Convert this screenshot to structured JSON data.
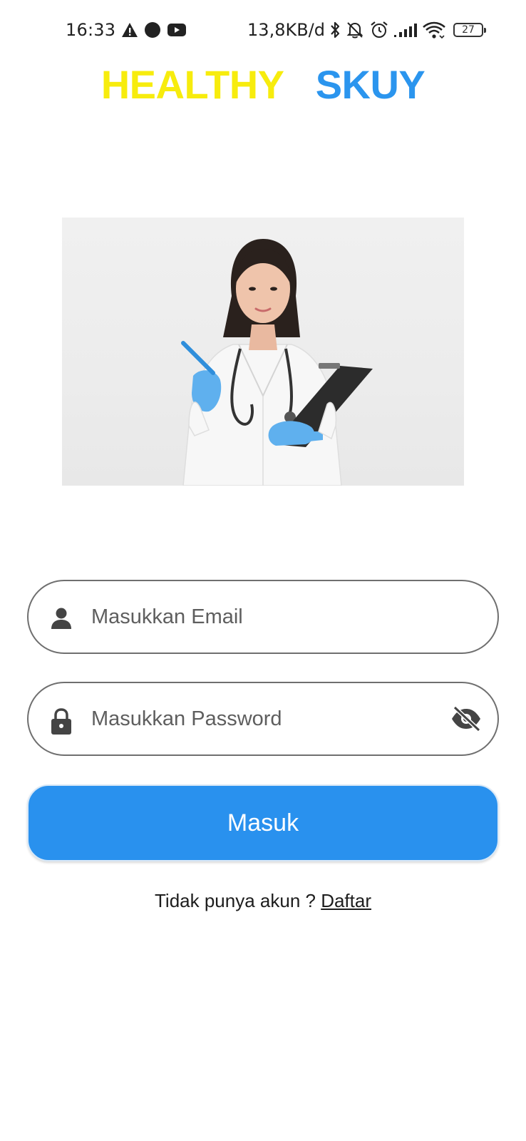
{
  "status_bar": {
    "time": "16:33",
    "network_speed": "13,8KB/d",
    "battery_level": "27",
    "icons": [
      "warning-icon",
      "notification-dot-icon",
      "youtube-icon",
      "bluetooth-icon",
      "silent-bell-icon",
      "alarm-icon",
      "signal-icon",
      "wifi-icon",
      "battery-icon"
    ]
  },
  "app": {
    "title_part_1": "HEALTHY",
    "title_part_2": "SKUY",
    "title_color_1": "#f7ec0d",
    "title_color_2": "#2b95ee"
  },
  "hero": {
    "description_icon": "doctor-illustration"
  },
  "login_form": {
    "email": {
      "placeholder": "Masukkan Email",
      "value": "",
      "icon": "person-icon"
    },
    "password": {
      "placeholder": "Masukkan Password",
      "value": "",
      "icon": "lock-icon",
      "toggle_icon": "eye-off-icon"
    },
    "submit_label": "Masuk",
    "accent_color": "#2991ee"
  },
  "register": {
    "prompt": "Tidak punya akun ? ",
    "link_label": "Daftar"
  }
}
